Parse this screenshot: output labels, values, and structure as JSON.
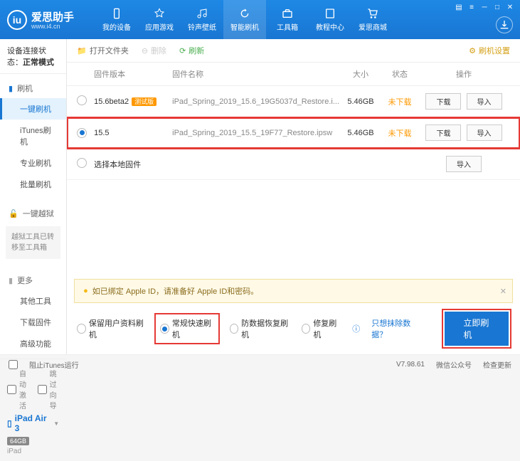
{
  "header": {
    "brand": "爱思助手",
    "brand_sub": "www.i4.cn",
    "nav": [
      "我的设备",
      "应用游戏",
      "铃声壁纸",
      "智能刷机",
      "工具箱",
      "教程中心",
      "爱思商城"
    ]
  },
  "sidebar": {
    "status_label": "设备连接状态：",
    "status_value": "正常模式",
    "sec_flash": "刷机",
    "items_flash": [
      "一键刷机",
      "iTunes刷机",
      "专业刷机",
      "批量刷机"
    ],
    "sec_jb": "一键越狱",
    "jb_notice": "越狱工具已转移至工具箱",
    "sec_more": "更多",
    "items_more": [
      "其他工具",
      "下载固件",
      "高级功能"
    ],
    "auto_activate": "自动激活",
    "skip_guide": "跳过向导",
    "device_name": "iPad Air 3",
    "device_storage": "64GB",
    "device_type": "iPad"
  },
  "toolbar": {
    "open_folder": "打开文件夹",
    "delete": "删除",
    "refresh": "刷新",
    "settings": "刷机设置"
  },
  "table": {
    "h_version": "固件版本",
    "h_name": "固件名称",
    "h_size": "大小",
    "h_status": "状态",
    "h_ops": "操作",
    "rows": [
      {
        "selected": false,
        "version": "15.6beta2",
        "tag": "测试版",
        "name": "iPad_Spring_2019_15.6_19G5037d_Restore.i...",
        "size": "5.46GB",
        "status": "未下载"
      },
      {
        "selected": true,
        "version": "15.5",
        "tag": "",
        "name": "iPad_Spring_2019_15.5_19F77_Restore.ipsw",
        "size": "5.46GB",
        "status": "未下载"
      }
    ],
    "local_fw": "选择本地固件",
    "btn_download": "下载",
    "btn_import": "导入"
  },
  "alert": {
    "text": "如已绑定 Apple ID，请准备好 Apple ID和密码。"
  },
  "options": {
    "o1": "保留用户资料刷机",
    "o2": "常规快速刷机",
    "o3": "防数据恢复刷机",
    "o4": "修复刷机",
    "link": "只想抹除数据？",
    "primary": "立即刷机"
  },
  "footer": {
    "block_itunes": "阻止iTunes运行",
    "version": "V7.98.61",
    "wechat": "微信公众号",
    "update": "检查更新"
  }
}
